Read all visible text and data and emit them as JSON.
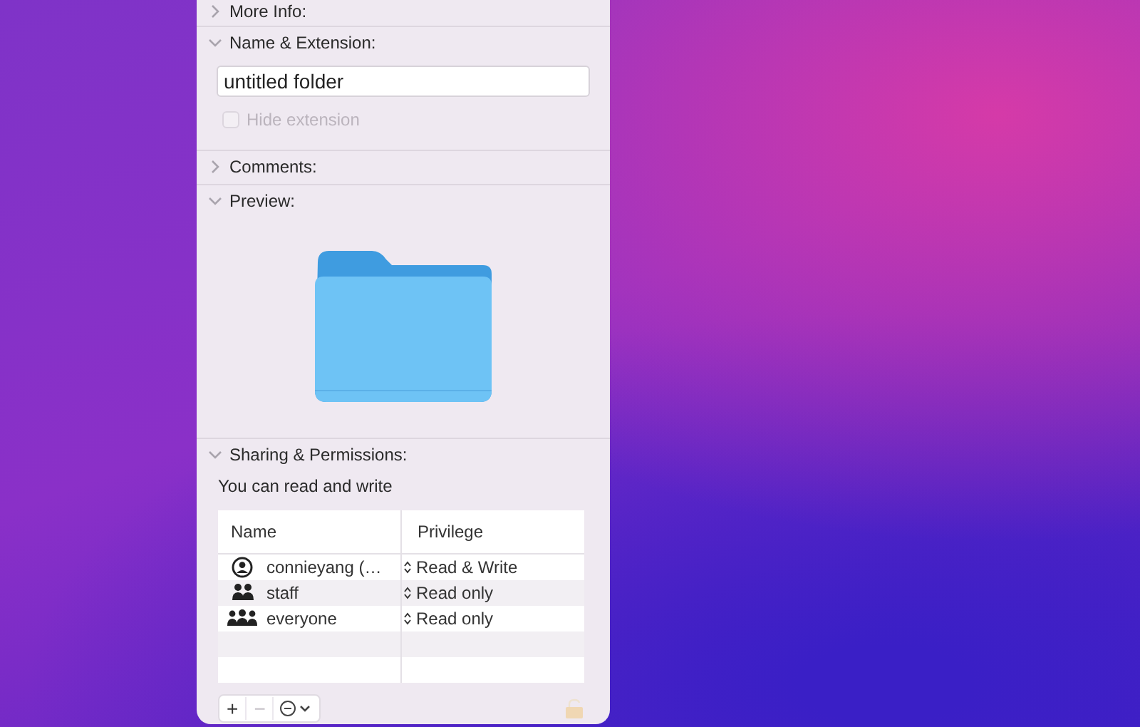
{
  "sections": [
    {
      "kind": "more_info",
      "title": "More Info:",
      "expanded": false
    },
    {
      "kind": "name",
      "title": "Name & Extension:",
      "expanded": true,
      "name_value": "untitled folder",
      "hide_extension": {
        "label": "Hide extension",
        "checked": false,
        "disabled": true
      }
    },
    {
      "kind": "comments",
      "title": "Comments:",
      "expanded": false
    },
    {
      "kind": "preview",
      "title": "Preview:",
      "expanded": true
    },
    {
      "kind": "sharing",
      "title": "Sharing & Permissions:",
      "expanded": true,
      "status": "You can read and write",
      "columns": [
        "Name",
        "Privilege"
      ],
      "rows": [
        {
          "kind": "user",
          "name": "connieyang (…",
          "privilege": "Read & Write"
        },
        {
          "kind": "group",
          "name": "staff",
          "privilege": "Read only"
        },
        {
          "kind": "everyone",
          "name": "everyone",
          "privilege": "Read only"
        }
      ],
      "buttons": [
        {
          "kind": "add",
          "label": "+",
          "disabled": false
        },
        {
          "kind": "remove",
          "label": "−",
          "disabled": true
        },
        {
          "kind": "action"
        }
      ],
      "locked": false
    }
  ]
}
